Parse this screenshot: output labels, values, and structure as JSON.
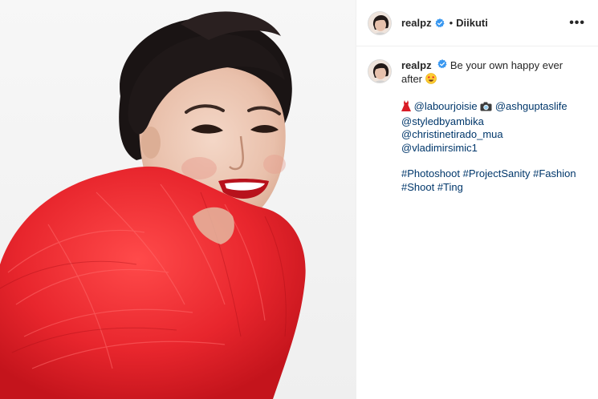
{
  "header": {
    "username": "realpz",
    "separator": "•",
    "follow_label": "Diikuti",
    "more_label": "•••"
  },
  "caption": {
    "username": "realpz",
    "text_line1": "Be your own happy ever",
    "text_line2": "after",
    "credits": {
      "dress_tag": "@labourjoisie",
      "camera_tag": "@ashguptaslife",
      "tag3": "@styledbyambika",
      "tag4": "@christinetirado_mua",
      "tag5": "@vladimirsimic1"
    },
    "hashtags_line1": [
      "#Photoshoot",
      "#ProjectSanity",
      "#Fashion"
    ],
    "hashtags_line2": [
      "#Shoot",
      "#Ting"
    ]
  },
  "icons": {
    "verified": "verified-badge-icon",
    "more": "more-options-icon",
    "dress": "red-dress-emoji",
    "camera": "camera-emoji",
    "star_eyes": "star-struck-emoji"
  },
  "colors": {
    "link": "#00376b",
    "verified": "#3897f0",
    "text": "#262626",
    "tutu": "#e8262d"
  }
}
